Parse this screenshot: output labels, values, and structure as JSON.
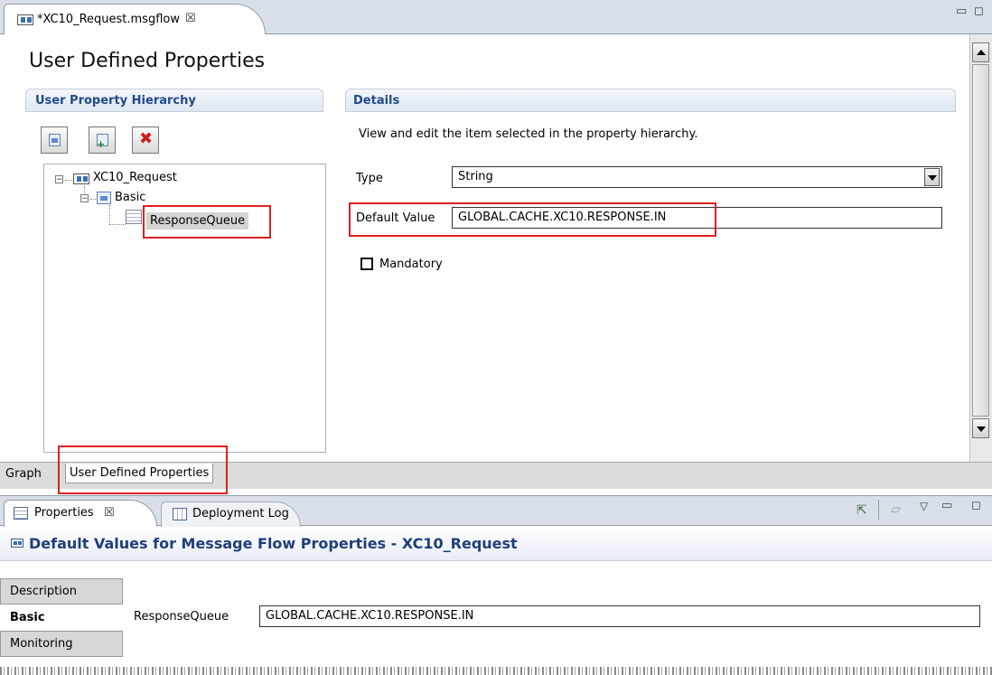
{
  "editor": {
    "tab_label": "*XC10_Request.msgflow",
    "close_glyph": "☒",
    "window_controls": "▭ ◻"
  },
  "form": {
    "title": "User Defined Properties",
    "hierarchy_title": "User Property Hierarchy",
    "details_title": "Details",
    "details_description": "View and edit the item selected in the property hierarchy.",
    "type_label": "Type",
    "type_value": "String",
    "default_label": "Default Value",
    "default_value": "GLOBAL.CACHE.XC10.RESPONSE.IN",
    "mandatory_label": "Mandatory"
  },
  "tree": {
    "root": "XC10_Request",
    "group": "Basic",
    "leaf": "ResponseQueue"
  },
  "page_tabs": {
    "graph": "Graph",
    "udp": "User Defined Properties"
  },
  "properties_view": {
    "tab_properties": "Properties",
    "tab_deployment_log": "Deployment Log",
    "header": "Default Values for Message Flow Properties - XC10_Request",
    "side_tabs": [
      "Description",
      "Basic",
      "Monitoring"
    ],
    "field_label": "ResponseQueue",
    "field_value": "GLOBAL.CACHE.XC10.RESPONSE.IN"
  },
  "colors": {
    "highlight": "#e0201f",
    "section_title": "#214a8c",
    "header_title": "#1f3f7a"
  }
}
